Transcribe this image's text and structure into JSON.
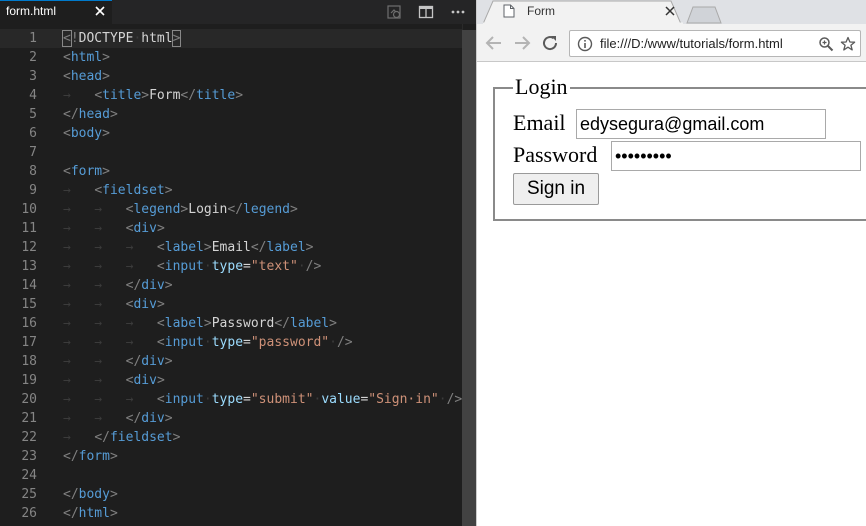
{
  "editor": {
    "tab": {
      "title": "form.html"
    },
    "lines": [
      {
        "n": "1",
        "tokens": [
          [
            "bracket",
            "<"
          ],
          [
            "punct",
            "!"
          ],
          [
            "text",
            "DOCTYPE"
          ],
          [
            "ws",
            "·"
          ],
          [
            "text",
            "html"
          ],
          [
            "bracket",
            ">"
          ]
        ]
      },
      {
        "n": "2",
        "tokens": [
          [
            "punct",
            "<"
          ],
          [
            "tag",
            "html"
          ],
          [
            "punct",
            ">"
          ]
        ]
      },
      {
        "n": "3",
        "tokens": [
          [
            "punct",
            "<"
          ],
          [
            "tag",
            "head"
          ],
          [
            "punct",
            ">"
          ]
        ]
      },
      {
        "n": "4",
        "tokens": [
          [
            "ws",
            "→   "
          ],
          [
            "punct",
            "<"
          ],
          [
            "tag",
            "title"
          ],
          [
            "punct",
            ">"
          ],
          [
            "text",
            "Form"
          ],
          [
            "punct",
            "</"
          ],
          [
            "tag",
            "title"
          ],
          [
            "punct",
            ">"
          ]
        ]
      },
      {
        "n": "5",
        "tokens": [
          [
            "punct",
            "</"
          ],
          [
            "tag",
            "head"
          ],
          [
            "punct",
            ">"
          ]
        ]
      },
      {
        "n": "6",
        "tokens": [
          [
            "punct",
            "<"
          ],
          [
            "tag",
            "body"
          ],
          [
            "punct",
            ">"
          ]
        ]
      },
      {
        "n": "7",
        "tokens": []
      },
      {
        "n": "8",
        "tokens": [
          [
            "punct",
            "<"
          ],
          [
            "tag",
            "form"
          ],
          [
            "punct",
            ">"
          ]
        ]
      },
      {
        "n": "9",
        "tokens": [
          [
            "ws",
            "→   "
          ],
          [
            "punct",
            "<"
          ],
          [
            "tag",
            "fieldset"
          ],
          [
            "punct",
            ">"
          ]
        ]
      },
      {
        "n": "10",
        "tokens": [
          [
            "ws",
            "→   →   "
          ],
          [
            "punct",
            "<"
          ],
          [
            "tag",
            "legend"
          ],
          [
            "punct",
            ">"
          ],
          [
            "text",
            "Login"
          ],
          [
            "punct",
            "</"
          ],
          [
            "tag",
            "legend"
          ],
          [
            "punct",
            ">"
          ]
        ]
      },
      {
        "n": "11",
        "tokens": [
          [
            "ws",
            "→   →   "
          ],
          [
            "punct",
            "<"
          ],
          [
            "tag",
            "div"
          ],
          [
            "punct",
            ">"
          ]
        ]
      },
      {
        "n": "12",
        "tokens": [
          [
            "ws",
            "→   →   →   "
          ],
          [
            "punct",
            "<"
          ],
          [
            "tag",
            "label"
          ],
          [
            "punct",
            ">"
          ],
          [
            "text",
            "Email"
          ],
          [
            "punct",
            "</"
          ],
          [
            "tag",
            "label"
          ],
          [
            "punct",
            ">"
          ]
        ]
      },
      {
        "n": "13",
        "tokens": [
          [
            "ws",
            "→   →   →   "
          ],
          [
            "punct",
            "<"
          ],
          [
            "tag",
            "input"
          ],
          [
            "ws",
            "·"
          ],
          [
            "attr",
            "type"
          ],
          [
            "text",
            "="
          ],
          [
            "str",
            "\"text\""
          ],
          [
            "ws",
            "·"
          ],
          [
            "punct",
            "/>"
          ]
        ]
      },
      {
        "n": "14",
        "tokens": [
          [
            "ws",
            "→   →   "
          ],
          [
            "punct",
            "</"
          ],
          [
            "tag",
            "div"
          ],
          [
            "punct",
            ">"
          ]
        ]
      },
      {
        "n": "15",
        "tokens": [
          [
            "ws",
            "→   →   "
          ],
          [
            "punct",
            "<"
          ],
          [
            "tag",
            "div"
          ],
          [
            "punct",
            ">"
          ]
        ]
      },
      {
        "n": "16",
        "tokens": [
          [
            "ws",
            "→   →   →   "
          ],
          [
            "punct",
            "<"
          ],
          [
            "tag",
            "label"
          ],
          [
            "punct",
            ">"
          ],
          [
            "text",
            "Password"
          ],
          [
            "punct",
            "</"
          ],
          [
            "tag",
            "label"
          ],
          [
            "punct",
            ">"
          ]
        ]
      },
      {
        "n": "17",
        "tokens": [
          [
            "ws",
            "→   →   →   "
          ],
          [
            "punct",
            "<"
          ],
          [
            "tag",
            "input"
          ],
          [
            "ws",
            "·"
          ],
          [
            "attr",
            "type"
          ],
          [
            "text",
            "="
          ],
          [
            "str",
            "\"password\""
          ],
          [
            "ws",
            "·"
          ],
          [
            "punct",
            "/>"
          ]
        ]
      },
      {
        "n": "18",
        "tokens": [
          [
            "ws",
            "→   →   "
          ],
          [
            "punct",
            "</"
          ],
          [
            "tag",
            "div"
          ],
          [
            "punct",
            ">"
          ]
        ]
      },
      {
        "n": "19",
        "tokens": [
          [
            "ws",
            "→   →   "
          ],
          [
            "punct",
            "<"
          ],
          [
            "tag",
            "div"
          ],
          [
            "punct",
            ">"
          ]
        ]
      },
      {
        "n": "20",
        "tokens": [
          [
            "ws",
            "→   →   →   "
          ],
          [
            "punct",
            "<"
          ],
          [
            "tag",
            "input"
          ],
          [
            "ws",
            "·"
          ],
          [
            "attr",
            "type"
          ],
          [
            "text",
            "="
          ],
          [
            "str",
            "\"submit\""
          ],
          [
            "ws",
            "·"
          ],
          [
            "attr",
            "value"
          ],
          [
            "text",
            "="
          ],
          [
            "str",
            "\"Sign·in\""
          ],
          [
            "ws",
            "·"
          ],
          [
            "punct",
            "/>"
          ]
        ]
      },
      {
        "n": "21",
        "tokens": [
          [
            "ws",
            "→   →   "
          ],
          [
            "punct",
            "</"
          ],
          [
            "tag",
            "div"
          ],
          [
            "punct",
            ">"
          ]
        ]
      },
      {
        "n": "22",
        "tokens": [
          [
            "ws",
            "→   "
          ],
          [
            "punct",
            "</"
          ],
          [
            "tag",
            "fieldset"
          ],
          [
            "punct",
            ">"
          ]
        ]
      },
      {
        "n": "23",
        "tokens": [
          [
            "punct",
            "</"
          ],
          [
            "tag",
            "form"
          ],
          [
            "punct",
            ">"
          ]
        ]
      },
      {
        "n": "24",
        "tokens": []
      },
      {
        "n": "25",
        "tokens": [
          [
            "punct",
            "</"
          ],
          [
            "tag",
            "body"
          ],
          [
            "punct",
            ">"
          ]
        ]
      },
      {
        "n": "26",
        "tokens": [
          [
            "punct",
            "</"
          ],
          [
            "tag",
            "html"
          ],
          [
            "punct",
            ">"
          ]
        ]
      }
    ]
  },
  "browser": {
    "tab": {
      "title": "Form"
    },
    "url": "file:///D:/www/tutorials/form.html",
    "form": {
      "legend": "Login",
      "email_label": "Email",
      "email_value": "edysegura@gmail.com",
      "password_label": "Password",
      "password_value": "•••••••••",
      "submit_label": "Sign in"
    }
  },
  "icons": {
    "tab_close": "close-icon",
    "editor_actions": [
      "open-preview-icon",
      "split-editor-icon",
      "more-actions-icon"
    ],
    "nav": [
      "back-icon",
      "forward-icon",
      "reload-icon",
      "info-icon",
      "zoom-icon",
      "star-icon",
      "page-icon",
      "new-tab-icon"
    ]
  },
  "colors": {
    "editor_bg": "#1e1e1e",
    "tag": "#569cd6",
    "attr": "#9cdcfe",
    "string": "#ce9178",
    "accent": "#007acc"
  }
}
